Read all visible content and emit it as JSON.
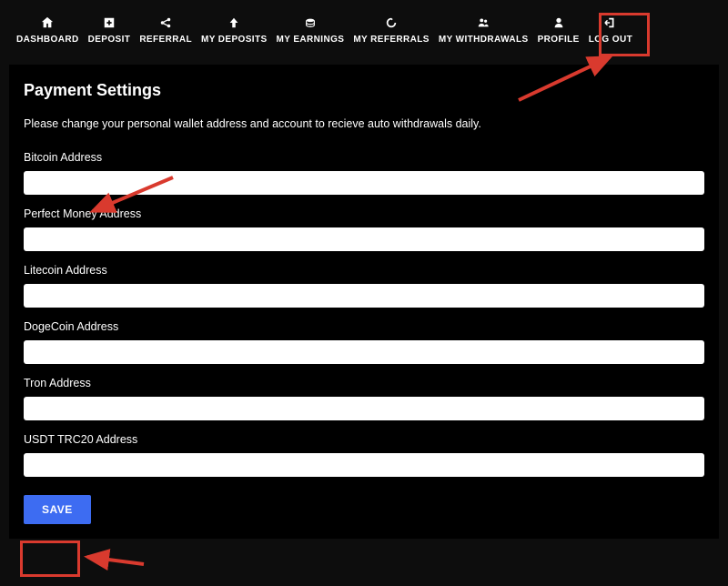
{
  "nav": {
    "dashboard": "DASHBOARD",
    "deposit": "DEPOSIT",
    "referral": "REFERRAL",
    "my_deposits": "MY DEPOSITS",
    "my_earnings": "MY EARNINGS",
    "my_referrals": "MY REFERRALS",
    "my_withdrawals": "MY WITHDRAWALS",
    "profile": "PROFILE",
    "logout": "LOG OUT"
  },
  "page": {
    "title": "Payment Settings",
    "description": "Please change your personal wallet address and account to recieve auto withdrawals daily."
  },
  "fields": {
    "bitcoin": {
      "label": "Bitcoin Address",
      "value": ""
    },
    "perfect_money": {
      "label": "Perfect Money Address",
      "value": ""
    },
    "litecoin": {
      "label": "Litecoin Address",
      "value": ""
    },
    "dogecoin": {
      "label": "DogeCoin Address",
      "value": ""
    },
    "tron": {
      "label": "Tron Address",
      "value": ""
    },
    "usdt_trc20": {
      "label": "USDT TRC20 Address",
      "value": ""
    }
  },
  "buttons": {
    "save": "SAVE"
  },
  "colors": {
    "accent": "#3d6cf2",
    "highlight": "#d93a2e",
    "bg": "#0d0d0d"
  }
}
